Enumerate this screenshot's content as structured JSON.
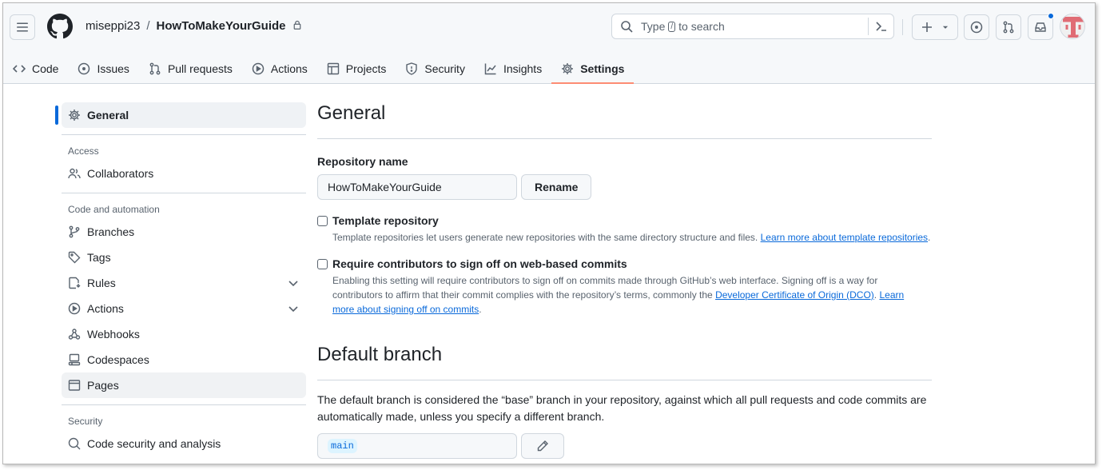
{
  "header": {
    "owner": "miseppi23",
    "separator": "/",
    "repo": "HowToMakeYourGuide",
    "search": {
      "before": "Type",
      "key": "/",
      "after": "to search"
    },
    "notification_dot_color": "#0969da"
  },
  "tabs": [
    {
      "label": "Code",
      "icon": "code-icon"
    },
    {
      "label": "Issues",
      "icon": "issue-icon"
    },
    {
      "label": "Pull requests",
      "icon": "pull-request-icon"
    },
    {
      "label": "Actions",
      "icon": "play-icon"
    },
    {
      "label": "Projects",
      "icon": "table-icon"
    },
    {
      "label": "Security",
      "icon": "shield-icon"
    },
    {
      "label": "Insights",
      "icon": "graph-icon"
    },
    {
      "label": "Settings",
      "icon": "gear-icon",
      "active": true
    }
  ],
  "sidebar": {
    "general": "General",
    "access_heading": "Access",
    "collaborators": "Collaborators",
    "code_automation_heading": "Code and automation",
    "branches": "Branches",
    "tags": "Tags",
    "rules": "Rules",
    "actions": "Actions",
    "webhooks": "Webhooks",
    "codespaces": "Codespaces",
    "pages": "Pages",
    "security_heading": "Security",
    "code_security": "Code security and analysis"
  },
  "main": {
    "title": "General",
    "repo_name_label": "Repository name",
    "repo_name_value": "HowToMakeYourGuide",
    "rename_button": "Rename",
    "template": {
      "title": "Template repository",
      "desc": "Template repositories let users generate new repositories with the same directory structure and files. ",
      "link": "Learn more about template repositories",
      "end": "."
    },
    "signoff": {
      "title": "Require contributors to sign off on web-based commits",
      "desc": "Enabling this setting will require contributors to sign off on commits made through GitHub’s web interface. Signing off is a way for contributors to affirm that their commit complies with the repository’s terms, commonly the ",
      "link1": "Developer Certificate of Origin (DCO)",
      "mid": ". ",
      "link2": "Learn more about signing off on commits",
      "end": "."
    },
    "default_branch_title": "Default branch",
    "default_branch_desc": "The default branch is considered the “base” branch in your repository, against which all pull requests and code commits are automatically made, unless you specify a different branch.",
    "branch_value": "main"
  },
  "colors": {
    "accent": "#0969da",
    "active_tab_underline": "#fd8c73"
  }
}
